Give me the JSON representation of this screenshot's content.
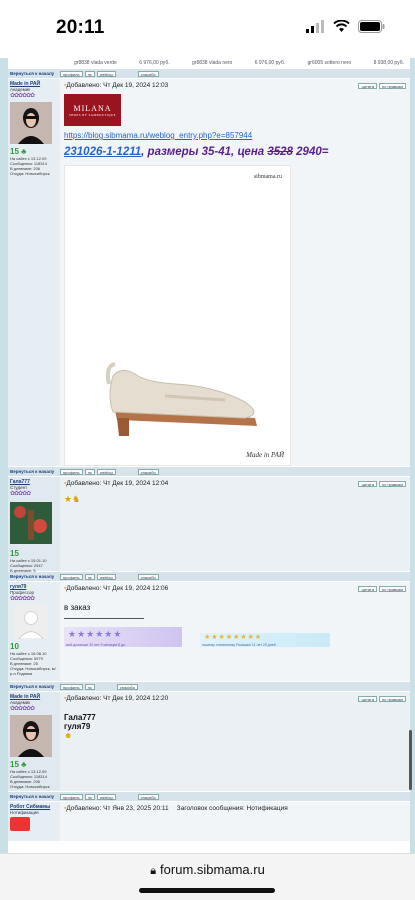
{
  "status": {
    "time": "20:11"
  },
  "top_strip": {
    "items": [
      "gr8838 vlada verde",
      "6 976,00 руб.",
      "gr8838 vlada nero",
      "6 976,00 руб.",
      "gr6005 sottero nero",
      "8 938,00 руб."
    ]
  },
  "nav": {
    "back_label": "Вернуться к началу",
    "profile": "профиль",
    "pm": "лс",
    "weblog": "weblog",
    "thanks": "спасибо",
    "quote": "цитата",
    "edit": "по правкам"
  },
  "posts": [
    {
      "user": "Made in РАЙ",
      "rank": "Академик",
      "stars": "✿✿✿✿✿✿",
      "score": "15",
      "info": [
        "На сайте с 13.12.09",
        "Сообщения: 118314",
        "В дневнике: 206",
        "Откуда: Новосибирск"
      ],
      "time": "Добавлено: Чт Дек 19, 2024 12:03",
      "logo": "MILANA",
      "logo_sub": "SHOES BY SAMBOUTIQUE",
      "link": "https://blog.sibmama.ru/weblog_entry.php?e=857944",
      "article_code": "231026-1-1211",
      "article_text": ", размеры 35-41, цена ",
      "price_old": "3528",
      "price_new": " 2940=",
      "watermark": "sibmama.ru",
      "photo_caption": "Made in РАЙ"
    },
    {
      "user": "Гала777",
      "rank": "Студент",
      "stars": "✿✿✿✿✿",
      "score": "15",
      "info": [
        "На сайте с 15.01.10",
        "Сообщения: 2947",
        "В дневнике: 5"
      ],
      "time": "Добавлено: Чт Дек 19, 2024 12:04"
    },
    {
      "user": "гуля79",
      "rank": "Профессор",
      "stars": "✿✿✿✿✿✿",
      "score": "10",
      "info": [
        "На сайте с 16.08.10",
        "Сообщения: 5979",
        "В дневнике: 25",
        "Откуда: Новосибирск, м/р-н Родники"
      ],
      "time": "Добавлено: Чт Дек 19, 2024 12:06",
      "text": "в заказ",
      "sig1": "мой дочаньке 20 лет 9 месяцев 8 дн",
      "sig2": "нашему племяннику Ромашке 11 лет 29 дней"
    },
    {
      "user": "Made in РАЙ",
      "rank": "Академик",
      "stars": "✿✿✿✿✿✿",
      "score": "15",
      "info": [
        "На сайте с 13.12.09",
        "Сообщения: 118314",
        "В дневнике: 206",
        "Откуда: Новосибирск"
      ],
      "time": "Добавлено: Чт Дек 19, 2024 12:20",
      "line1": "Гала777",
      "line2": "гуля79"
    },
    {
      "user": "Робот Сибмамы",
      "rank": "Нотификация",
      "time": "Добавлено: Чт Янв 23, 2025 20:11",
      "subject": "Заголовок сообщения: Нотификация"
    }
  ],
  "browser": {
    "url": "forum.sibmama.ru"
  }
}
